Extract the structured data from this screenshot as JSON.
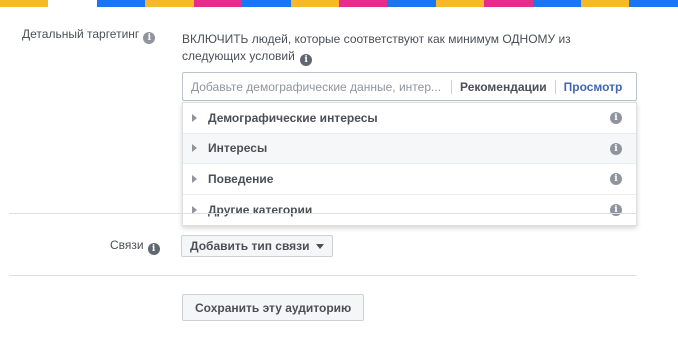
{
  "stripe_colors": [
    "#f7b928",
    "#ffffff",
    "#1877f2",
    "#f7b928",
    "#e42d8c",
    "#1877f2",
    "#f7b928",
    "#e42d8c",
    "#1877f2",
    "#f7b928",
    "#e42d8c",
    "#1877f2",
    "#f7b928",
    "#1877f2"
  ],
  "detailed_targeting": {
    "label": "Детальный таргетинг",
    "include_text": "ВКЛЮЧИТЬ людей, которые соответствуют как минимум ОДНОМУ из следующих условий",
    "search_placeholder": "Добавьте демографические данные, интер...",
    "recommendations_label": "Рекомендации",
    "browse_label": "Просмотр"
  },
  "dropdown": {
    "items": [
      {
        "label": "Демографические интересы"
      },
      {
        "label": "Интересы"
      },
      {
        "label": "Поведение"
      },
      {
        "label": "Другие категории"
      }
    ]
  },
  "connections": {
    "label": "Связи",
    "button_label": "Добавить тип связи"
  },
  "save_audience_label": "Сохранить эту аудиторию",
  "info_glyph": "i"
}
